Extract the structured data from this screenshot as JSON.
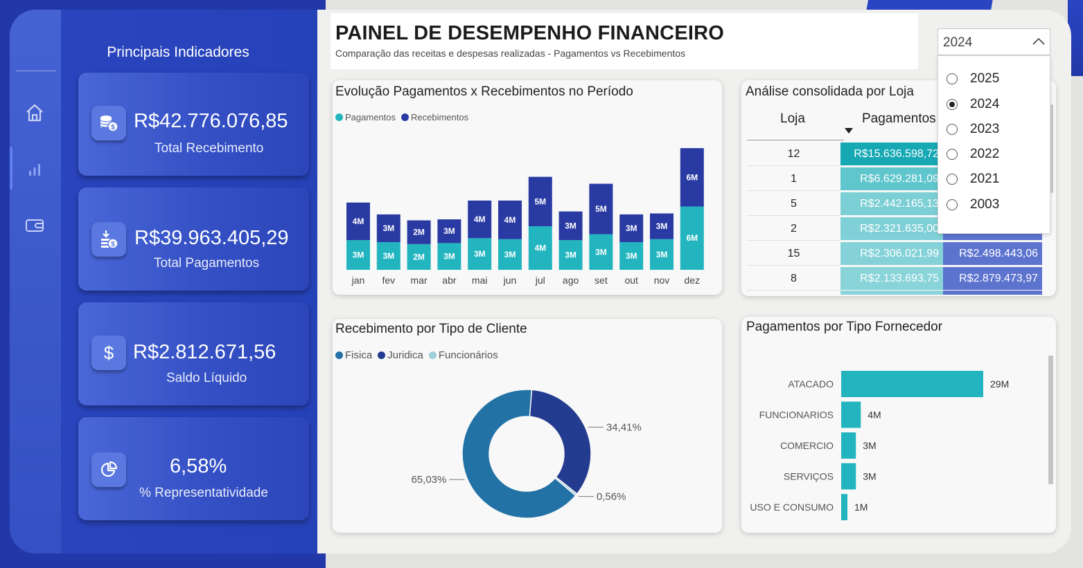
{
  "sidebar": {
    "title": "Principais Indicadores",
    "nav": [
      {
        "icon": "home-icon"
      },
      {
        "icon": "bar-chart-icon",
        "active": true
      },
      {
        "icon": "wallet-icon"
      }
    ],
    "kpis": [
      {
        "icon": "coins-icon",
        "value": "R$42.776.076,85",
        "label": "Total Recebimento"
      },
      {
        "icon": "payment-icon",
        "value": "R$39.963.405,29",
        "label": "Total Pagamentos"
      },
      {
        "icon": "dollar-icon",
        "icon_text": "$",
        "value": "R$2.812.671,56",
        "label": "Saldo Líquido"
      },
      {
        "icon": "pie-icon",
        "value": "6,58%",
        "label": "% Representatividade"
      }
    ]
  },
  "header": {
    "title": "PAINEL DE DESEMPENHO FINANCEIRO",
    "subtitle": "Comparação das receitas e despesas realizadas - Pagamentos vs Recebimentos"
  },
  "year_filter": {
    "selected": "2024",
    "options": [
      "2025",
      "2024",
      "2023",
      "2022",
      "2021",
      "2003"
    ]
  },
  "colors": {
    "pagamentos": "#22b5bf",
    "recebimentos": "#2a3aa3",
    "fisica": "#2272a6",
    "juridica": "#243c8f",
    "funcionarios": "#9ed0d9"
  },
  "monthly": {
    "title": "Evolução Pagamentos x Recebimentos no Período",
    "legend": [
      "Pagamentos",
      "Recebimentos"
    ]
  },
  "table": {
    "title": "Análise consolidada por Loja",
    "headers": [
      "Loja",
      "Pagamentos"
    ],
    "rows": [
      {
        "loja": "12",
        "pagamentos": "R$15.636.598,72",
        "recebimentos": ""
      },
      {
        "loja": "1",
        "pagamentos": "R$6.629.281,09",
        "recebimentos": ""
      },
      {
        "loja": "5",
        "pagamentos": "R$2.442.165,13",
        "recebimentos": ""
      },
      {
        "loja": "2",
        "pagamentos": "R$2.321.635,00",
        "recebimentos": ""
      },
      {
        "loja": "15",
        "pagamentos": "R$2.306.021,99",
        "recebimentos": "R$2.498.443,06"
      },
      {
        "loja": "8",
        "pagamentos": "R$2.133.693,75",
        "recebimentos": "R$2.879.473,97"
      }
    ],
    "row_shades": [
      "#16a9b4",
      "#5fc6cd",
      "#7ccfd5",
      "#80d1d7",
      "#84d2d8",
      "#88d4d9"
    ]
  },
  "donut": {
    "title": "Recebimento por Tipo de Cliente",
    "legend": [
      "Fisica",
      "Juridica",
      "Funcionários"
    ]
  },
  "suppliers": {
    "title": "Pagamentos por Tipo Fornecedor"
  },
  "chart_data": [
    {
      "type": "bar",
      "stacked": true,
      "title": "Evolução Pagamentos x Recebimentos no Período",
      "categories": [
        "jan",
        "fev",
        "mar",
        "abr",
        "mai",
        "jun",
        "jul",
        "ago",
        "set",
        "out",
        "nov",
        "dez"
      ],
      "series": [
        {
          "name": "Pagamentos",
          "values": [
            3.0,
            2.8,
            2.6,
            2.7,
            3.2,
            3.1,
            4.4,
            3.0,
            3.6,
            2.8,
            3.1,
            6.4
          ],
          "labels": [
            "3M",
            "3M",
            "2M",
            "3M",
            "3M",
            "3M",
            "4M",
            "3M",
            "3M",
            "3M",
            "3M",
            "6M"
          ]
        },
        {
          "name": "Recebimentos",
          "values": [
            3.8,
            2.8,
            2.4,
            2.4,
            3.8,
            3.9,
            5.0,
            2.9,
            5.1,
            2.8,
            2.6,
            5.9
          ],
          "labels": [
            "4M",
            "3M",
            "2M",
            "3M",
            "4M",
            "4M",
            "5M",
            "3M",
            "5M",
            "3M",
            "3M",
            "6M"
          ]
        }
      ],
      "legend_position": "top-left",
      "grid": false
    },
    {
      "type": "pie",
      "donut": true,
      "title": "Recebimento por Tipo de Cliente",
      "categories": [
        "Fisica",
        "Juridica",
        "Funcionários"
      ],
      "values": [
        65.03,
        34.41,
        0.56
      ],
      "labels": [
        "65,03%",
        "34,41%",
        "0,56%"
      ],
      "legend_position": "top-left"
    },
    {
      "type": "bar",
      "orientation": "horizontal",
      "title": "Pagamentos por Tipo Fornecedor",
      "categories": [
        "ATACADO",
        "FUNCIONARIOS",
        "COMERCIO",
        "SERVIÇOS",
        "USO E CONSUMO"
      ],
      "values": [
        29,
        4,
        3,
        3,
        1
      ],
      "labels": [
        "29M",
        "4M",
        "3M",
        "3M",
        "1M"
      ],
      "unit": "M"
    }
  ]
}
